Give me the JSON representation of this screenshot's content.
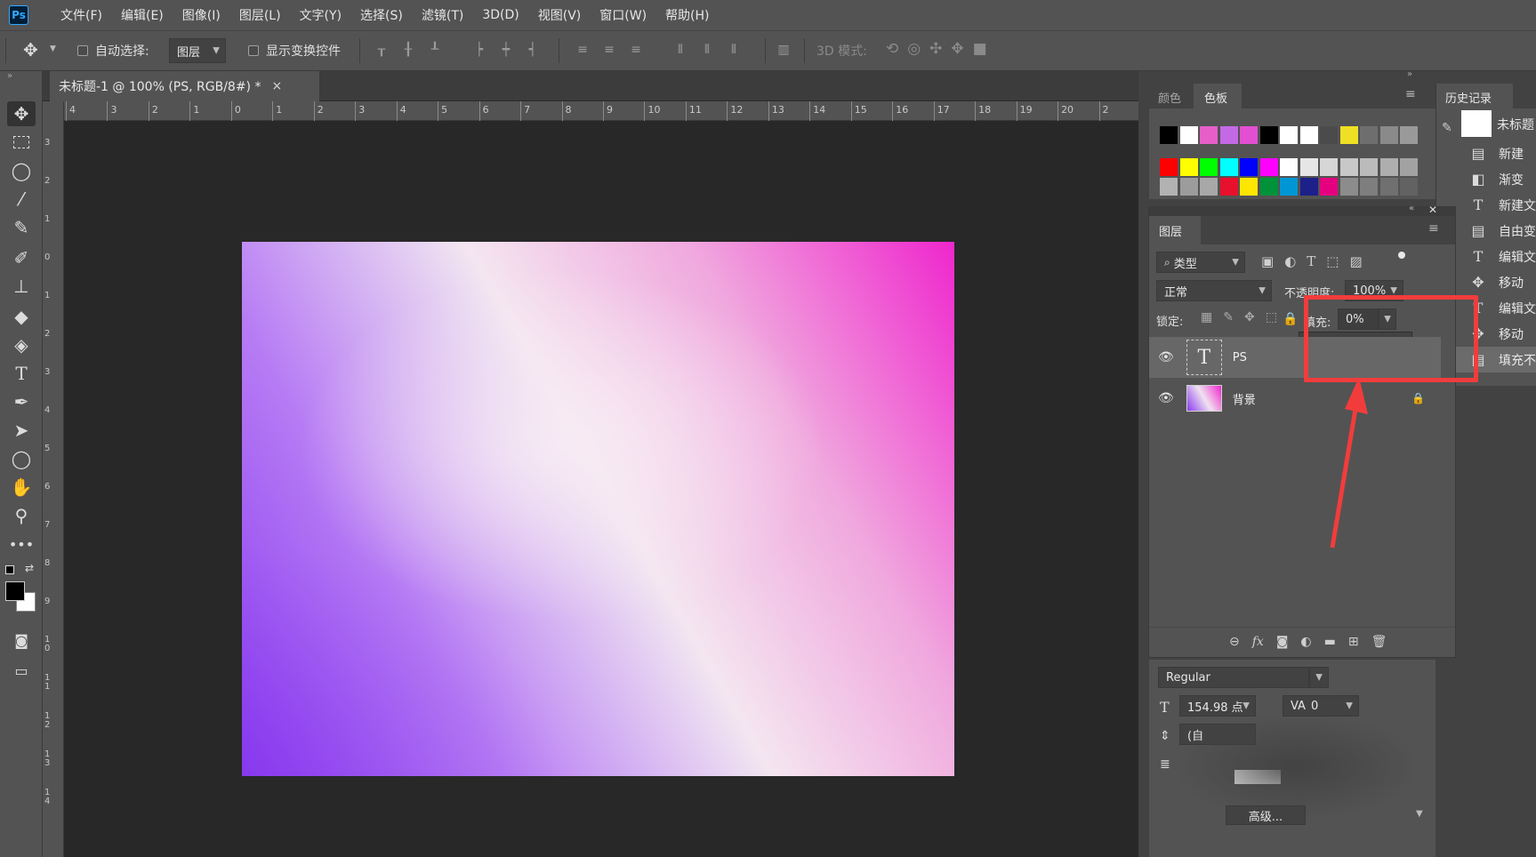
{
  "app": {
    "logo": "Ps"
  },
  "menu": [
    "文件(F)",
    "编辑(E)",
    "图像(I)",
    "图层(L)",
    "文字(Y)",
    "选择(S)",
    "滤镜(T)",
    "3D(D)",
    "视图(V)",
    "窗口(W)",
    "帮助(H)"
  ],
  "options": {
    "auto_select_label": "自动选择:",
    "auto_select_target": "图层",
    "show_transform_label": "显示变换控件",
    "mode_3d_label": "3D 模式:"
  },
  "document": {
    "tab_title": "未标题-1 @ 100% (PS, RGB/8#) *",
    "close_glyph": "×"
  },
  "rulers": {
    "h": [
      "4",
      "3",
      "2",
      "1",
      "0",
      "1",
      "2",
      "3",
      "4",
      "5",
      "6",
      "7",
      "8",
      "9",
      "10",
      "11",
      "12",
      "13",
      "14",
      "15",
      "16",
      "17",
      "18",
      "19",
      "20",
      "2"
    ],
    "v": [
      "3",
      "2",
      "1",
      "0",
      "1",
      "2",
      "3",
      "4",
      "5",
      "6",
      "7",
      "8",
      "9",
      "10",
      "11",
      "12",
      "13",
      "14"
    ]
  },
  "swatch_panel": {
    "tabs": [
      "颜色",
      "色板"
    ],
    "row1": [
      "#000000",
      "#ffffff",
      "#e85ec8",
      "#c469e6",
      "#e34fd2",
      "#000000",
      "#ffffff",
      "#ffffff",
      "#4b4b4b",
      "#f0e024",
      "#6e6e6e",
      "#8a8a8a",
      "#9a9a9a"
    ],
    "row2": [
      "#ff0000",
      "#ffff00",
      "#00ff00",
      "#00ffff",
      "#0000ff",
      "#ff00ff",
      "#ffffff",
      "#e6e6e6",
      "#d6d6d6",
      "#c8c8c8",
      "#bbbbbb",
      "#aeaeae",
      "#a2a2a2"
    ],
    "row3": [
      "#b2b2b2",
      "#9c9c9c",
      "#a8a8a8",
      "#e8102c",
      "#ffe600",
      "#00923a",
      "#0096d6",
      "#1d2088",
      "#e4007f",
      "#8c8c8c",
      "#7e7e7e",
      "#707070",
      "#626262"
    ]
  },
  "layers_panel": {
    "title": "图层",
    "filter_label": "类型",
    "blend_mode": "正常",
    "opacity_label": "不透明度:",
    "opacity_value": "100%",
    "lock_label": "锁定:",
    "fill_label": "填充:",
    "fill_value": "0%",
    "fill_slider_fraction": 0,
    "layers": [
      {
        "name": "PS",
        "thumb": "T"
      },
      {
        "name": "背景",
        "thumb": ""
      }
    ]
  },
  "history_panel": {
    "title": "历史记录",
    "snapshot_label": "未标题",
    "items": [
      {
        "icon": "doc-icon",
        "label": "新建"
      },
      {
        "icon": "gradient-icon",
        "label": "渐变"
      },
      {
        "icon": "type-icon",
        "label": "新建文"
      },
      {
        "icon": "doc-icon",
        "label": "自由变"
      },
      {
        "icon": "type-icon",
        "label": "编辑文"
      },
      {
        "icon": "move-icon",
        "label": "移动"
      },
      {
        "icon": "type-icon",
        "label": "编辑文"
      },
      {
        "icon": "move-icon",
        "label": "移动"
      },
      {
        "icon": "doc-icon",
        "label": "填充不"
      }
    ]
  },
  "character_panel": {
    "font_style": "Regular",
    "font_size": "154.98 点",
    "tracking_value": "0",
    "leading_partial": "(自",
    "advanced_button": "高级..."
  },
  "annotation": {
    "color": "#f23c3c"
  }
}
